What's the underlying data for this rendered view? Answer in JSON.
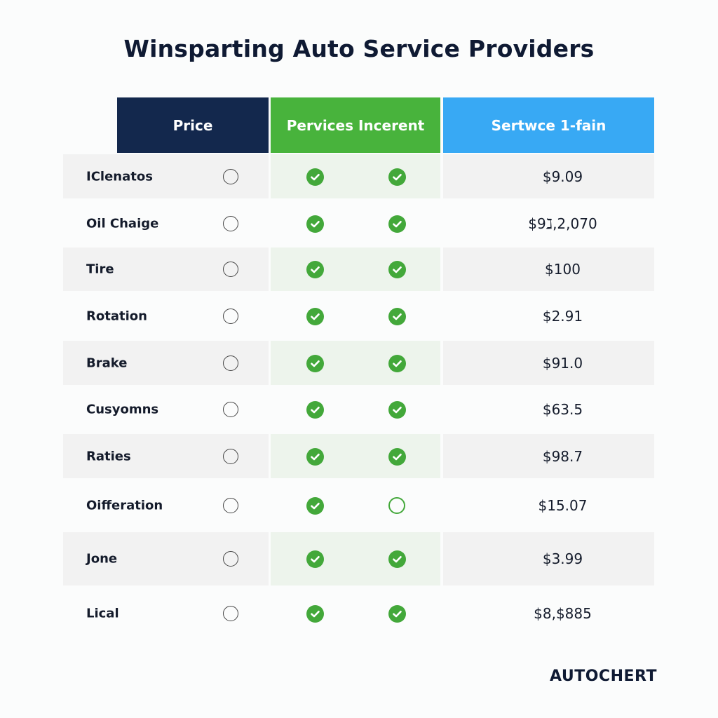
{
  "title": "Winsparting Auto Service Providers",
  "headers": {
    "price": "Price",
    "services": "Pervices Incerent",
    "service_alt": "Sertwce 1-fain"
  },
  "colors": {
    "header_price": "#13284d",
    "header_services": "#48b33c",
    "header_service_alt": "#38a9f4",
    "check_green": "#43a83a",
    "title_text": "#0f1a33"
  },
  "rows": [
    {
      "name": "IClenatos",
      "radio": "empty",
      "check1": true,
      "check2": true,
      "price": "$9.09"
    },
    {
      "name": "Oil Chaige",
      "radio": "empty",
      "check1": true,
      "check2": true,
      "price": "$9ℷ,2,070"
    },
    {
      "name": "Tire",
      "radio": "empty",
      "check1": true,
      "check2": true,
      "price": "$100"
    },
    {
      "name": "Rotation",
      "radio": "empty",
      "check1": true,
      "check2": true,
      "price": "$2.91"
    },
    {
      "name": "Brake",
      "radio": "empty",
      "check1": true,
      "check2": true,
      "price": "$91.0"
    },
    {
      "name": "Cusyomns",
      "radio": "empty",
      "check1": true,
      "check2": true,
      "price": "$63.5"
    },
    {
      "name": "Raties",
      "radio": "empty",
      "check1": true,
      "check2": true,
      "price": "$98.7"
    },
    {
      "name": "Oifferation",
      "radio": "empty",
      "check1": true,
      "check2": false,
      "price": "$15.07"
    },
    {
      "name": "Jone",
      "radio": "empty",
      "check1": true,
      "check2": true,
      "price": "$3.99"
    },
    {
      "name": "Lical",
      "radio": "empty",
      "check1": true,
      "check2": true,
      "price": "$8,$885"
    }
  ],
  "brand": "AUTOCHERT"
}
